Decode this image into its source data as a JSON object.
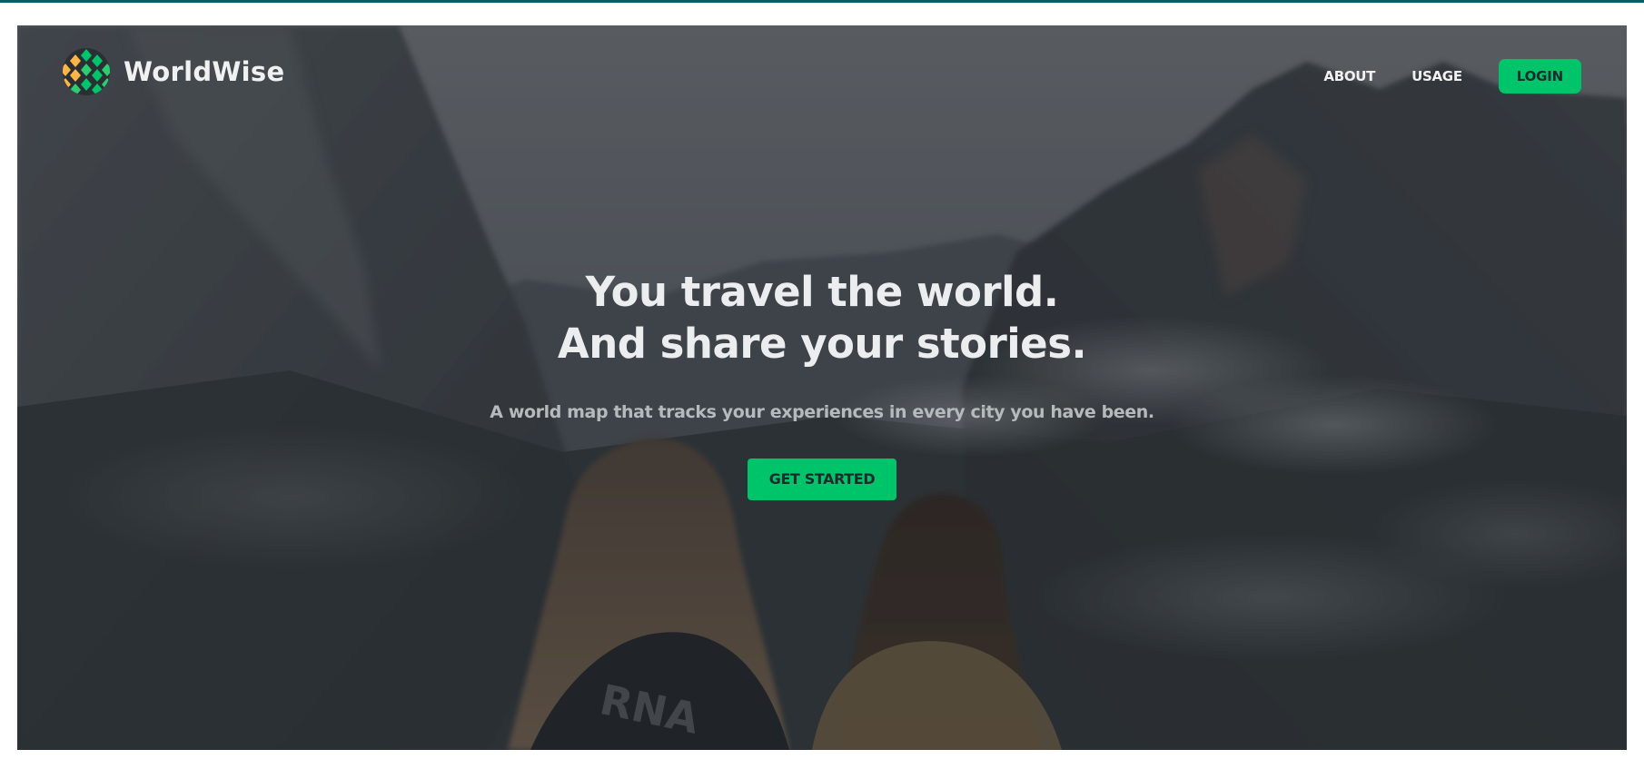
{
  "brand": {
    "name": "WorldWise",
    "logo_icon": "globe-logo-icon",
    "logo_colors": [
      "#ffb545",
      "#00c46a",
      "#2ecc71"
    ]
  },
  "nav": {
    "links": [
      {
        "label": "ABOUT"
      },
      {
        "label": "USAGE"
      }
    ],
    "login_label": "LOGIN"
  },
  "hero": {
    "headline_line1": "You travel the world.",
    "headline_line2": "And share your stories.",
    "subtitle": "A world map that tracks your experiences in every city you have been.",
    "cta_label": "GET STARTED",
    "background": "mountain-valley-photo-with-two-travelers"
  },
  "colors": {
    "accent": "#00c46a",
    "top_bar": "#0e5a66",
    "text_light": "#ebedee",
    "text_muted": "#b5babc"
  }
}
